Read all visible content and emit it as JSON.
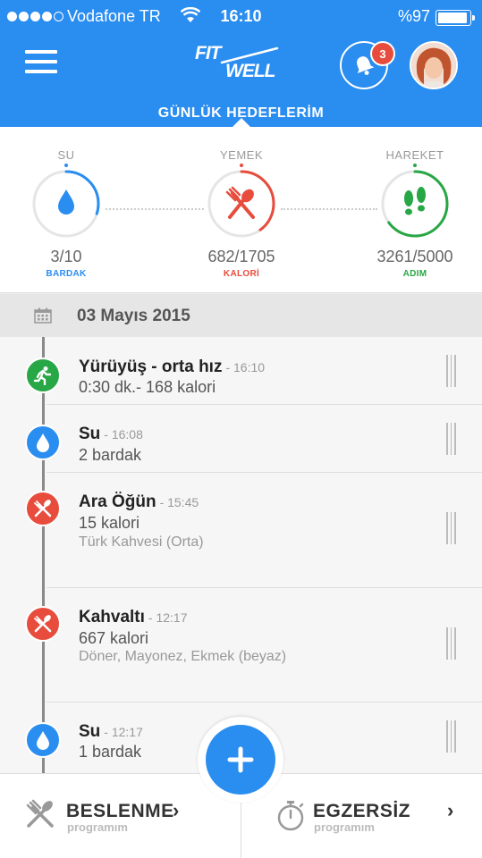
{
  "status_bar": {
    "carrier": "Vodafone TR",
    "time": "16:10",
    "battery": "%97"
  },
  "header": {
    "logo_line1": "FIT",
    "logo_line2": "WELL",
    "notification_count": "3",
    "section_title": "GÜNLÜK HEDEFLERİM"
  },
  "goals": [
    {
      "label": "SU",
      "value": "3/10",
      "unit": "BARDAK",
      "color": "#2a8df0",
      "progress": 0.3,
      "icon": "water-drop-icon"
    },
    {
      "label": "YEMEK",
      "value": "682/1705",
      "unit": "KALORİ",
      "color": "#e74c3c",
      "progress": 0.4,
      "icon": "fork-spoon-icon"
    },
    {
      "label": "HAREKET",
      "value": "3261/5000",
      "unit": "ADIM",
      "color": "#27a745",
      "progress": 0.65,
      "icon": "footsteps-icon"
    }
  ],
  "date": "03 Mayıs 2015",
  "timeline": [
    {
      "title": "Yürüyüş - orta hız",
      "time": "- 16:10",
      "line2": "0:30 dk.- 168 kalori",
      "line3": "",
      "type": "exercise",
      "color": "#27a745",
      "icon": "running-icon"
    },
    {
      "title": "Su",
      "time": "- 16:08",
      "line2": "2 bardak",
      "line3": "",
      "type": "water",
      "color": "#2a8df0",
      "icon": "water-drop-icon"
    },
    {
      "title": "Ara Öğün",
      "time": "- 15:45",
      "line2": "15 kalori",
      "line3": "Türk Kahvesi (Orta)",
      "type": "food",
      "color": "#e74c3c",
      "icon": "fork-knife-icon"
    },
    {
      "title": "Kahvaltı",
      "time": "- 12:17",
      "line2": "667 kalori",
      "line3": "Döner, Mayonez, Ekmek (beyaz)",
      "type": "food",
      "color": "#e74c3c",
      "icon": "fork-knife-icon"
    },
    {
      "title": "Su",
      "time": "- 12:17",
      "line2": "1 bardak",
      "line3": "",
      "type": "water",
      "color": "#2a8df0",
      "icon": "water-drop-icon"
    }
  ],
  "bottom_bar": {
    "left_title": "BESLENME",
    "left_sub": "programım",
    "right_title": "EGZERSİZ",
    "right_sub": "programım"
  }
}
